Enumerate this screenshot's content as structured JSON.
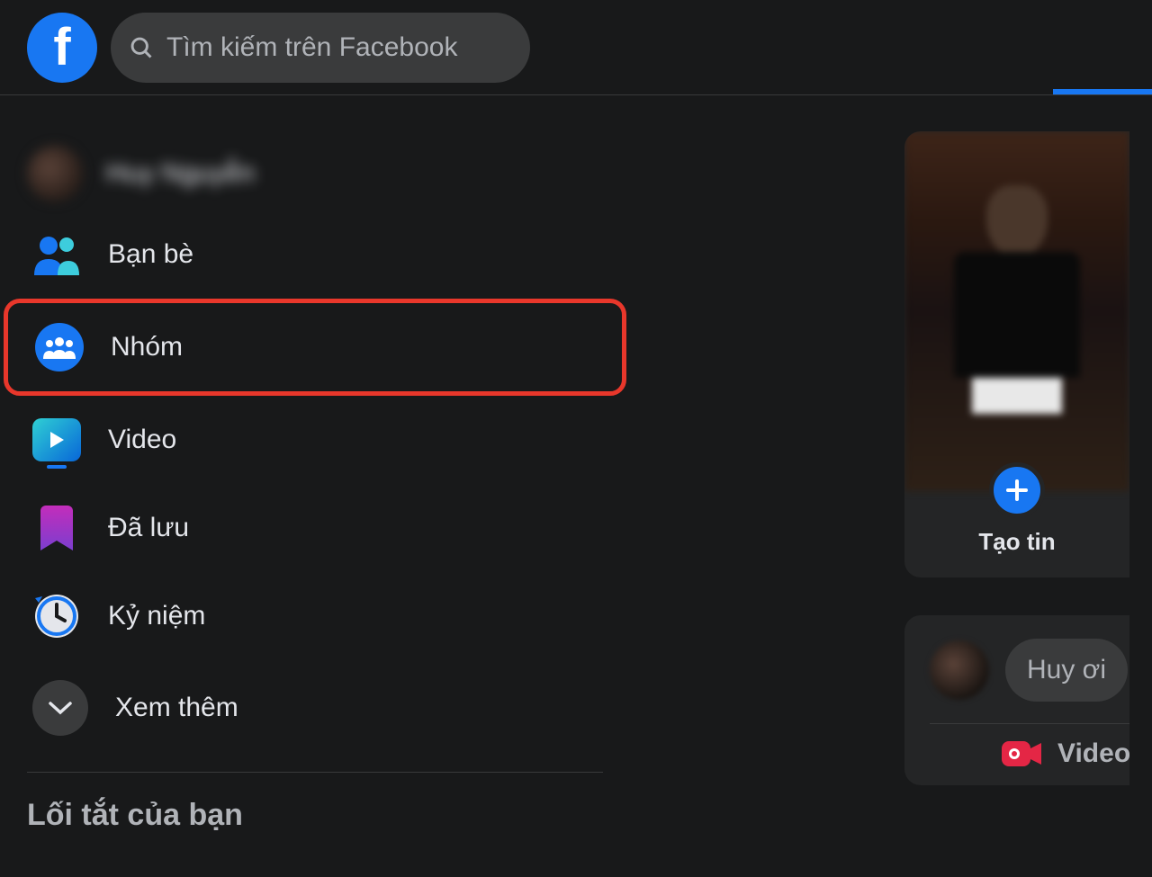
{
  "header": {
    "search_placeholder": "Tìm kiếm trên Facebook"
  },
  "sidebar": {
    "profile_name": "Huy Nguyễn",
    "items": [
      {
        "label": "Bạn bè"
      },
      {
        "label": "Nhóm"
      },
      {
        "label": "Video"
      },
      {
        "label": "Đã lưu"
      },
      {
        "label": "Kỷ niệm"
      },
      {
        "label": "Xem thêm"
      }
    ],
    "shortcuts_title": "Lối tắt của bạn"
  },
  "story": {
    "create_label": "Tạo tin"
  },
  "composer": {
    "placeholder": "Huy ơi",
    "live_video_label": "Video"
  }
}
